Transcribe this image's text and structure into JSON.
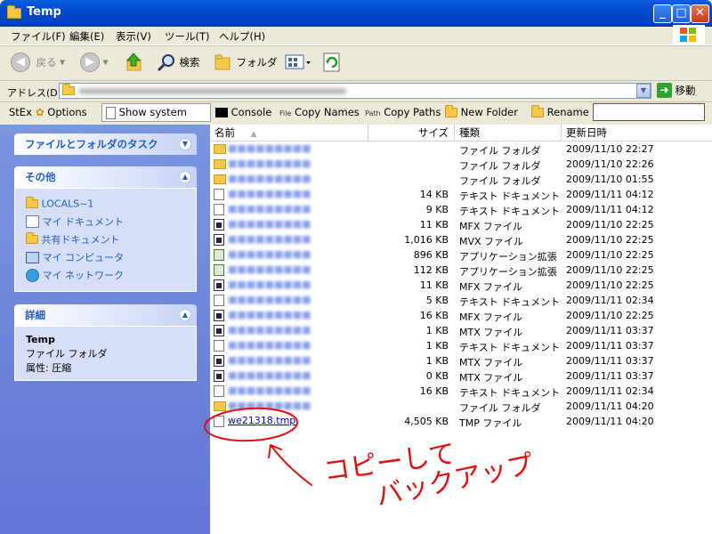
{
  "window": {
    "title": "Temp"
  },
  "menu": [
    "ファイル(F)",
    "編集(E)",
    "表示(V)",
    "ツール(T)",
    "ヘルプ(H)"
  ],
  "toolbar": {
    "back": "戻る",
    "search": "検索",
    "folders": "フォルダ"
  },
  "address": {
    "label": "アドレス(D)",
    "go": "移動"
  },
  "stex": {
    "label": "StEx",
    "options": "Options",
    "show_system": "Show system files",
    "console": "Console",
    "copy_names": "Copy Names",
    "copy_paths": "Copy Paths",
    "new_folder": "New Folder",
    "rename": "Rename"
  },
  "tasks": {
    "title": "ファイルとフォルダのタスク"
  },
  "other": {
    "title": "その他",
    "items": [
      "LOCALS~1",
      "マイ ドキュメント",
      "共有ドキュメント",
      "マイ コンピュータ",
      "マイ ネットワーク"
    ]
  },
  "details": {
    "title": "詳細",
    "name": "Temp",
    "type": "ファイル フォルダ",
    "attr": "属性: 圧縮"
  },
  "columns": {
    "name": "名前",
    "size": "サイズ",
    "type": "種類",
    "date": "更新日時"
  },
  "files": [
    {
      "icon": "folder",
      "name": "",
      "blurred": true,
      "size": "",
      "type": "ファイル フォルダ",
      "date": "2009/11/10 22:27"
    },
    {
      "icon": "folder",
      "name": "",
      "blurred": true,
      "size": "",
      "type": "ファイル フォルダ",
      "date": "2009/11/10 22:26"
    },
    {
      "icon": "folder",
      "name": "",
      "blurred": true,
      "size": "",
      "type": "ファイル フォルダ",
      "date": "2009/11/10 01:55"
    },
    {
      "icon": "doc",
      "name": "",
      "blurred": true,
      "size": "14 KB",
      "type": "テキスト ドキュメント",
      "date": "2009/11/11 04:12"
    },
    {
      "icon": "doc",
      "name": "",
      "blurred": true,
      "size": "9 KB",
      "type": "テキスト ドキュメント",
      "date": "2009/11/11 04:12"
    },
    {
      "icon": "mfx",
      "name": "",
      "blurred": true,
      "size": "11 KB",
      "type": "MFX ファイル",
      "date": "2009/11/10 22:25"
    },
    {
      "icon": "mfx",
      "name": "",
      "blurred": true,
      "size": "1,016 KB",
      "type": "MVX ファイル",
      "date": "2009/11/10 22:25"
    },
    {
      "icon": "app",
      "name": "",
      "blurred": true,
      "size": "896 KB",
      "type": "アプリケーション拡張",
      "date": "2009/11/10 22:25"
    },
    {
      "icon": "app",
      "name": "",
      "blurred": true,
      "size": "112 KB",
      "type": "アプリケーション拡張",
      "date": "2009/11/10 22:25"
    },
    {
      "icon": "mfx",
      "name": "",
      "blurred": true,
      "size": "11 KB",
      "type": "MFX ファイル",
      "date": "2009/11/10 22:25"
    },
    {
      "icon": "doc",
      "name": "",
      "blurred": true,
      "size": "5 KB",
      "type": "テキスト ドキュメント",
      "date": "2009/11/11 02:34"
    },
    {
      "icon": "mfx",
      "name": "",
      "blurred": true,
      "size": "16 KB",
      "type": "MFX ファイル",
      "date": "2009/11/10 22:25"
    },
    {
      "icon": "mfx",
      "name": "",
      "blurred": true,
      "size": "1 KB",
      "type": "MTX ファイル",
      "date": "2009/11/11 03:37"
    },
    {
      "icon": "doc",
      "name": "",
      "blurred": true,
      "size": "1 KB",
      "type": "テキスト ドキュメント",
      "date": "2009/11/11 03:37"
    },
    {
      "icon": "mfx",
      "name": "",
      "blurred": true,
      "size": "1 KB",
      "type": "MTX ファイル",
      "date": "2009/11/11 03:37"
    },
    {
      "icon": "mfx",
      "name": "",
      "blurred": true,
      "size": "0 KB",
      "type": "MTX ファイル",
      "date": "2009/11/11 03:37"
    },
    {
      "icon": "doc",
      "name": "",
      "blurred": true,
      "size": "16 KB",
      "type": "テキスト ドキュメント",
      "date": "2009/11/11 02:34"
    },
    {
      "icon": "folder",
      "name": "",
      "blurred": true,
      "size": "",
      "type": "ファイル フォルダ",
      "date": "2009/11/11 04:20"
    },
    {
      "icon": "doc",
      "name": "we21318.tmp",
      "blurred": false,
      "size": "4,505 KB",
      "type": "TMP ファイル",
      "date": "2009/11/11 04:20"
    }
  ],
  "annotation": {
    "line1": "コピーして",
    "line2": "バックアップ",
    "color": "#e01010"
  },
  "colors": {
    "titlebar": "#0a5fe0",
    "panel_text": "#215dc6",
    "link": "#0000c8"
  }
}
